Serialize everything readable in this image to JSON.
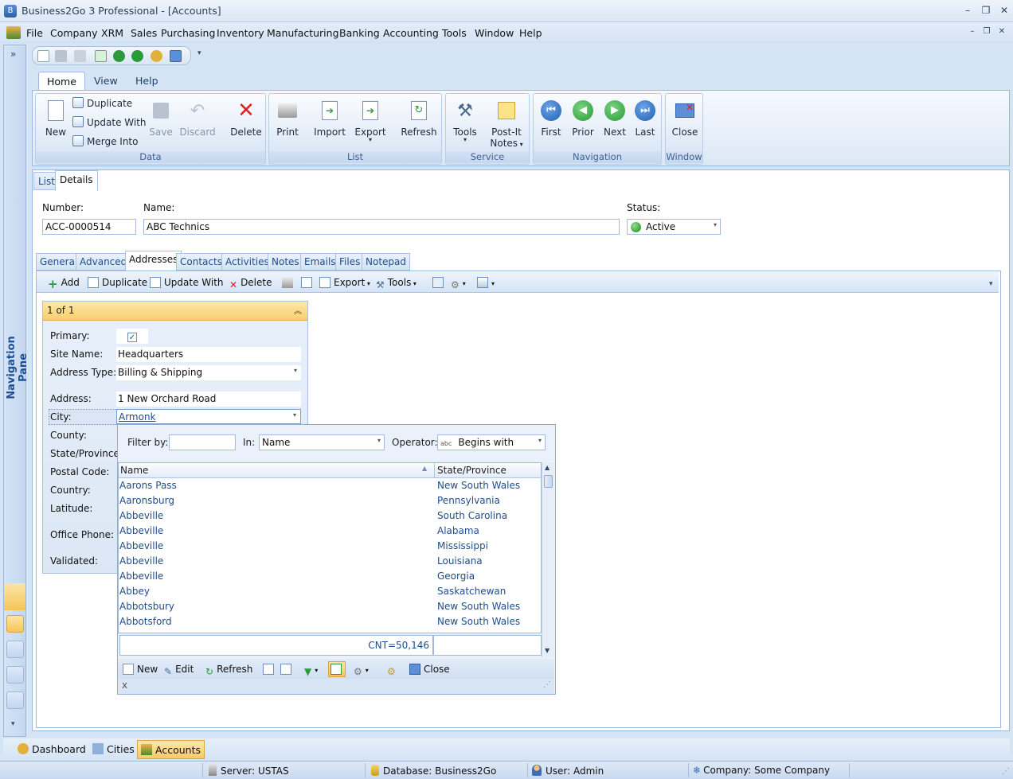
{
  "window": {
    "title": "Business2Go 3 Professional - [Accounts]"
  },
  "menu": [
    "File",
    "Company",
    "XRM",
    "Sales",
    "Purchasing",
    "Inventory",
    "Manufacturing",
    "Banking",
    "Accounting",
    "Tools",
    "Window",
    "Help"
  ],
  "nav_pane": {
    "label": "Navigation Pane",
    "expand": "»"
  },
  "ribbon": {
    "tabs": [
      "Home",
      "View",
      "Help"
    ],
    "groups": {
      "data": "Data",
      "list": "List",
      "service": "Service",
      "navigation": "Navigation",
      "window": "Window"
    },
    "buttons": {
      "new": "New",
      "duplicate": "Duplicate",
      "update_with": "Update With",
      "merge_into": "Merge Into",
      "save": "Save",
      "discard": "Discard",
      "delete": "Delete",
      "print": "Print",
      "import": "Import",
      "export": "Export",
      "refresh": "Refresh",
      "tools": "Tools",
      "postit_1": "Post-It",
      "postit_2": "Notes",
      "first": "First",
      "prior": "Prior",
      "next": "Next",
      "last": "Last",
      "close": "Close"
    }
  },
  "view_tabs": [
    "List",
    "Details"
  ],
  "header": {
    "number_label": "Number:",
    "number_value": "ACC-0000514",
    "name_label": "Name:",
    "name_value": "ABC Technics",
    "status_label": "Status:",
    "status_value": "Active"
  },
  "sub_tabs": [
    "General",
    "Advanced",
    "Addresses",
    "Contacts",
    "Activities",
    "Notes",
    "Emails",
    "Files",
    "Notepad"
  ],
  "grid_toolbar": {
    "add": "Add",
    "duplicate": "Duplicate",
    "update_with": "Update With",
    "delete": "Delete",
    "export": "Export",
    "tools": "Tools"
  },
  "card": {
    "header": "1 of 1",
    "labels": {
      "primary": "Primary:",
      "site_name": "Site Name:",
      "address_type": "Address Type:",
      "address": "Address:",
      "city": "City:",
      "county": "County:",
      "state": "State/Province:",
      "postal": "Postal Code:",
      "country": "Country:",
      "latitude": "Latitude:",
      "office_phone": "Office Phone:",
      "validated": "Validated:"
    },
    "values": {
      "primary_check": "✓",
      "site_name": "Headquarters",
      "address_type": "Billing & Shipping",
      "address": "1 New Orchard Road",
      "city": "Armonk"
    }
  },
  "city_dropdown": {
    "filter_label": "Filter by:",
    "filter_value": "",
    "in_label": "In:",
    "in_value": "Name",
    "operator_label": "Operator:",
    "operator_badge": "abc",
    "operator_value": "Begins with",
    "columns": [
      "Name",
      "State/Province"
    ],
    "rows": [
      {
        "name": "Aarons Pass",
        "state": "New South Wales"
      },
      {
        "name": "Aaronsburg",
        "state": "Pennsylvania"
      },
      {
        "name": "Abbeville",
        "state": "South Carolina"
      },
      {
        "name": "Abbeville",
        "state": "Alabama"
      },
      {
        "name": "Abbeville",
        "state": "Mississippi"
      },
      {
        "name": "Abbeville",
        "state": "Louisiana"
      },
      {
        "name": "Abbeville",
        "state": "Georgia"
      },
      {
        "name": "Abbey",
        "state": "Saskatchewan"
      },
      {
        "name": "Abbotsbury",
        "state": "New South Wales"
      },
      {
        "name": "Abbotsford",
        "state": "New South Wales"
      }
    ],
    "count": "CNT=50,146",
    "toolbar": {
      "new": "New",
      "edit": "Edit",
      "refresh": "Refresh",
      "close": "Close"
    },
    "footer_close": "x"
  },
  "doc_tabs": [
    "Dashboard",
    "Cities",
    "Accounts"
  ],
  "status_bar": {
    "server": "Server: USTAS",
    "database": "Database: Business2Go",
    "user": "User: Admin",
    "company": "Company: Some Company"
  },
  "colors": {
    "accent": "#f8cf6e",
    "link": "#1e4d8c",
    "chrome": "#d5e4f4",
    "delete_red": "#e02020",
    "nav_blue": "#1f5fb0",
    "nav_green": "#2a9a3a"
  }
}
